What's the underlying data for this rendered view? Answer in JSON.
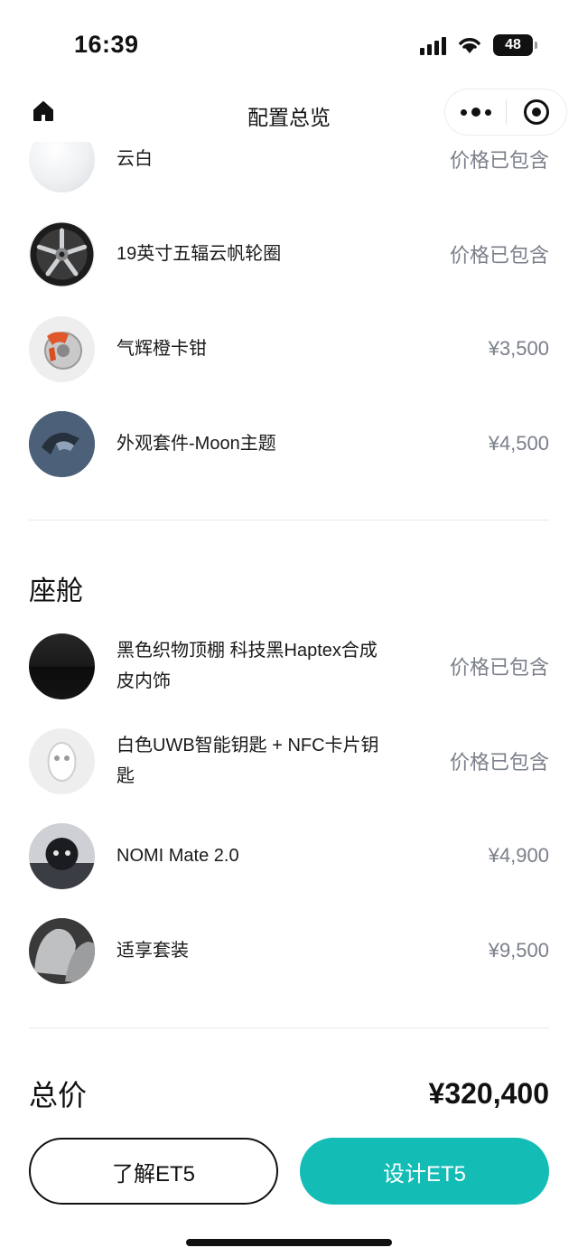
{
  "status_bar": {
    "time": "16:39",
    "battery": "48"
  },
  "nav": {
    "title": "配置总览",
    "home_icon": "home-icon",
    "more_icon": "more-dots-icon",
    "close_icon": "target-close-icon"
  },
  "exterior_items": [
    {
      "name": "云白",
      "price": "价格已包含",
      "thumb": "white-paint-swatch"
    },
    {
      "name": "19英寸五辐云帆轮圈",
      "price": "价格已包含",
      "thumb": "wheel-rim"
    },
    {
      "name": "气辉橙卡钳",
      "price": "¥3,500",
      "thumb": "orange-brake-caliper"
    },
    {
      "name": "外观套件-Moon主题",
      "price": "¥4,500",
      "thumb": "moon-theme-kit"
    }
  ],
  "cabin": {
    "title": "座舱",
    "items": [
      {
        "name": "黑色织物顶棚 科技黑Haptex合成皮内饰",
        "price": "价格已包含",
        "thumb": "black-fabric-swatch"
      },
      {
        "name": "白色UWB智能钥匙 + NFC卡片钥匙",
        "price": "价格已包含",
        "thumb": "smart-key"
      },
      {
        "name": "NOMI Mate 2.0",
        "price": "¥4,900",
        "thumb": "nomi-mate"
      },
      {
        "name": "适享套装",
        "price": "¥9,500",
        "thumb": "comfort-seat-package"
      }
    ]
  },
  "total": {
    "label": "总价",
    "value": "¥320,400"
  },
  "buttons": {
    "learn": "了解ET5",
    "design": "设计ET5"
  },
  "colors": {
    "accent": "#14bcb6",
    "price_gray": "#7a7f8a",
    "text": "#1a1a1a"
  }
}
